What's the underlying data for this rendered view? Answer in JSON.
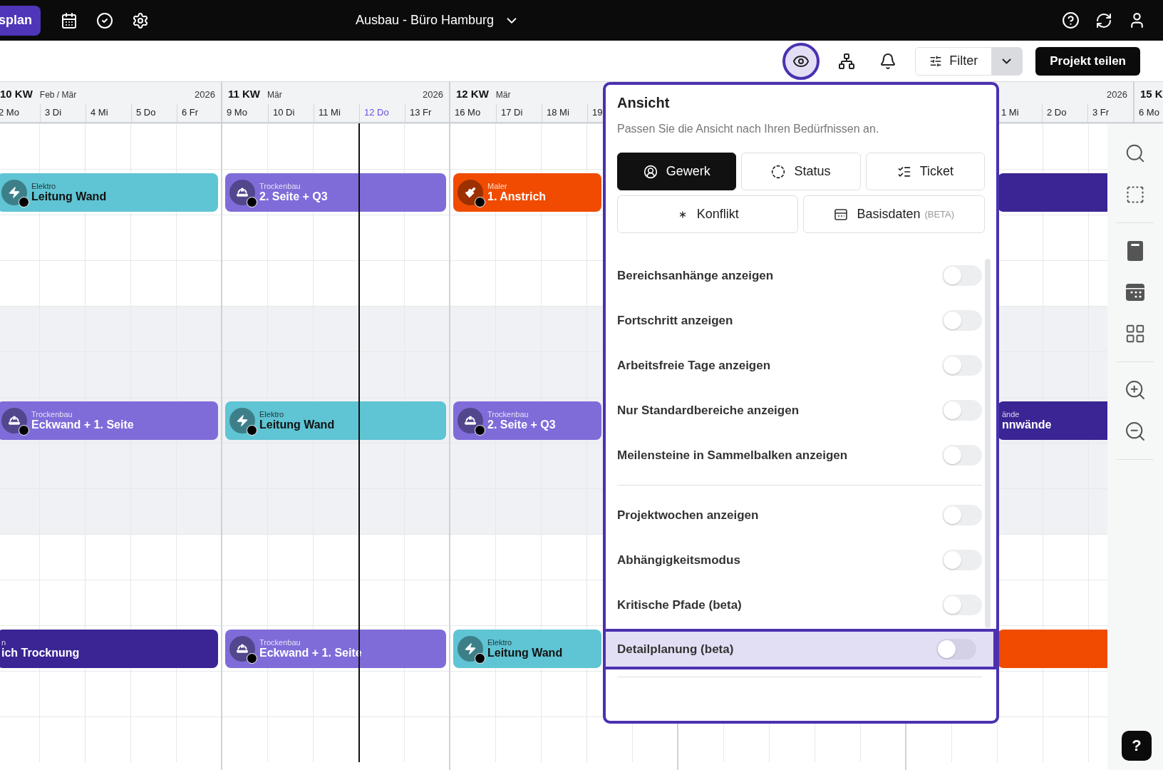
{
  "topbar": {
    "app_button": "splan",
    "project": "Ausbau - Büro Hamburg"
  },
  "toolbar": {
    "view_button": {
      "selected": true
    },
    "filter": "Filter",
    "share": "Projekt teilen"
  },
  "weeks": [
    {
      "label": "10 KW",
      "month": "Feb / Mär",
      "year": "2026",
      "days": [
        {
          "label": "2 Mo",
          "today": false
        },
        {
          "label": "3 Di",
          "today": false
        },
        {
          "label": "4 Mi",
          "today": false
        },
        {
          "label": "5 Do",
          "today": false
        },
        {
          "label": "6 Fr",
          "today": false
        }
      ],
      "bars": [
        {
          "trade": "Elektro",
          "title": "Leitung Wand",
          "color": "#5fc4d3",
          "kind": "electric"
        },
        {
          "trade": "Trockenbau",
          "title": "Eckwand + 1. Seite",
          "color": "#7f6cd9",
          "kind": "drywall"
        },
        {
          "trade": "n",
          "title": "ich Trocknung",
          "color": "#3b2494",
          "kind": "plain"
        }
      ]
    },
    {
      "label": "11 KW",
      "month": "Mär",
      "year": "2026",
      "days": [
        {
          "label": "9 Mo",
          "today": false
        },
        {
          "label": "10 Di",
          "today": false
        },
        {
          "label": "11 Mi",
          "today": false
        },
        {
          "label": "12 Do",
          "today": true
        },
        {
          "label": "13 Fr",
          "today": false
        }
      ],
      "bars": [
        {
          "trade": "Trockenbau",
          "title": "2. Seite + Q3",
          "color": "#7f6cd9",
          "kind": "drywall"
        },
        {
          "trade": "Elektro",
          "title": "Leitung Wand",
          "color": "#5fc4d3",
          "kind": "electric"
        },
        {
          "trade": "Trockenbau",
          "title": "Eckwand + 1. Seite",
          "color": "#7f6cd9",
          "kind": "drywall"
        }
      ]
    },
    {
      "label": "12 KW",
      "month": "Mär",
      "days": [
        {
          "label": "16 Mo",
          "today": false
        },
        {
          "label": "17 Di",
          "today": false
        },
        {
          "label": "18 Mi",
          "today": false
        },
        {
          "label": "19",
          "today": false
        }
      ],
      "bars": [
        {
          "trade": "Maler",
          "title": "1. Anstrich",
          "color": "#f04b00",
          "kind": "paint"
        },
        {
          "trade": "Trockenbau",
          "title": "2. Seite + Q3",
          "color": "#7f6cd9",
          "kind": "drywall"
        },
        {
          "trade": "Elektro",
          "title": "Leitung Wand",
          "color": "#5fc4d3",
          "kind": "electric"
        }
      ]
    },
    {
      "year": "2026",
      "days": [
        {
          "label": "1 Mi",
          "today": false
        },
        {
          "label": "2 Do",
          "today": false
        },
        {
          "label": "3 Fr",
          "today": false
        }
      ],
      "bars": [
        {
          "color": "#3b2494",
          "kind": "plain"
        },
        {
          "trade": "ände",
          "title": "nnwände",
          "color": "#3b2494",
          "kind": "plain"
        },
        {
          "color": "#f04b00",
          "kind": "plain"
        }
      ]
    },
    {
      "label": "15 K",
      "days": [
        {
          "label": "6 Mo",
          "today": false
        }
      ]
    }
  ],
  "panel": {
    "title": "Ansicht",
    "subtitle": "Passen Sie die Ansicht nach Ihren Bedürfnissen an.",
    "view_modes": [
      {
        "label": "Gewerk",
        "kind": "trade",
        "selected": true
      },
      {
        "label": "Status",
        "kind": "status",
        "selected": false
      },
      {
        "label": "Ticket",
        "kind": "ticket",
        "selected": false
      },
      {
        "label": "Konflikt",
        "kind": "conflict",
        "selected": false
      },
      {
        "label": "Basisdaten",
        "tag": "(BETA)",
        "kind": "basedata",
        "selected": false
      }
    ],
    "setting_groups": [
      [
        {
          "label": "Bereichsanhänge anzeigen",
          "on": false,
          "highlighted": false
        },
        {
          "label": "Fortschritt anzeigen",
          "on": false,
          "highlighted": false
        },
        {
          "label": "Arbeitsfreie Tage anzeigen",
          "on": false,
          "highlighted": false
        },
        {
          "label": "Nur Standardbereiche anzeigen",
          "on": false,
          "highlighted": false
        },
        {
          "label": "Meilensteine in Sammelbalken anzeigen",
          "on": false,
          "highlighted": false
        }
      ],
      [
        {
          "label": "Projektwochen anzeigen",
          "on": false,
          "highlighted": false
        },
        {
          "label": "Abhängigkeitsmodus",
          "on": false,
          "highlighted": false
        },
        {
          "label": "Kritische Pfade (beta)",
          "on": false,
          "highlighted": false
        },
        {
          "label": "Detailplanung (beta)",
          "on": false,
          "highlighted": true
        }
      ]
    ]
  },
  "help_button": "?"
}
